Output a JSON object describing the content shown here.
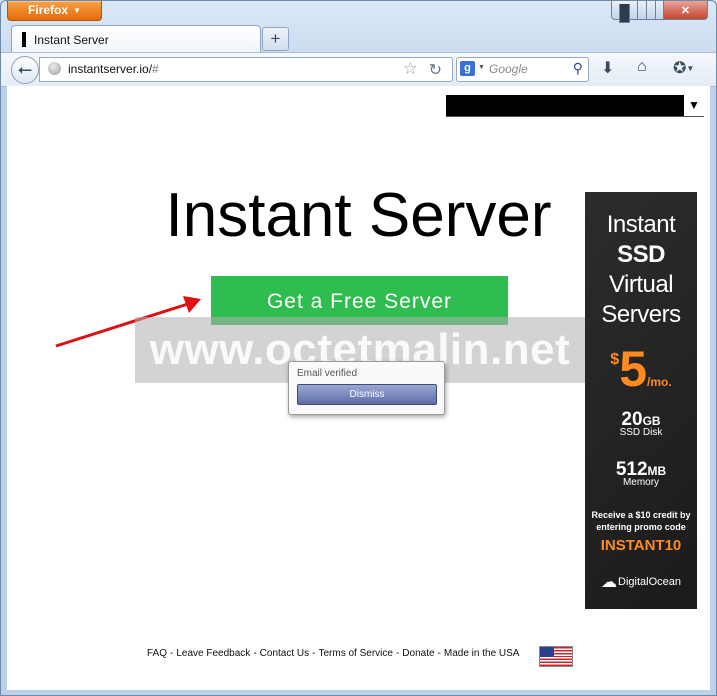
{
  "browser": {
    "menu_button": "Firefox",
    "tab_title": "Instant Server",
    "url_main": "instantserver.io/",
    "url_hash": "#",
    "search_engine_letter": "g",
    "search_placeholder": "Google"
  },
  "page": {
    "title": "Instant Server",
    "cta_label": "Get a Free Server",
    "watermark": "www.octetmalin.net",
    "popup_message": "Email verified",
    "popup_button": "Dismiss",
    "dropdown_arrow": "▼"
  },
  "ad": {
    "line1": "Instant",
    "line2": "SSD",
    "line3": "Virtual",
    "line4": "Servers",
    "price_symbol": "$",
    "price": "5",
    "price_unit": "/mo.",
    "spec1_value": "20",
    "spec1_unit": "GB",
    "spec1_label": "SSD Disk",
    "spec2_value": "512",
    "spec2_unit": "MB",
    "spec2_label": "Memory",
    "promo_text": "Receive a $10 credit by entering promo code",
    "promo_code": "INSTANT10",
    "brand": "DigitalOcean"
  },
  "footer": {
    "links": [
      "FAQ",
      "Leave Feedback",
      "Contact Us",
      "Terms of Service",
      "Donate",
      "Made in the USA"
    ]
  },
  "colors": {
    "cta": "#2ebd4e",
    "promo_accent": "#ff8a1f",
    "firefox_orange": "#e66a0a"
  }
}
